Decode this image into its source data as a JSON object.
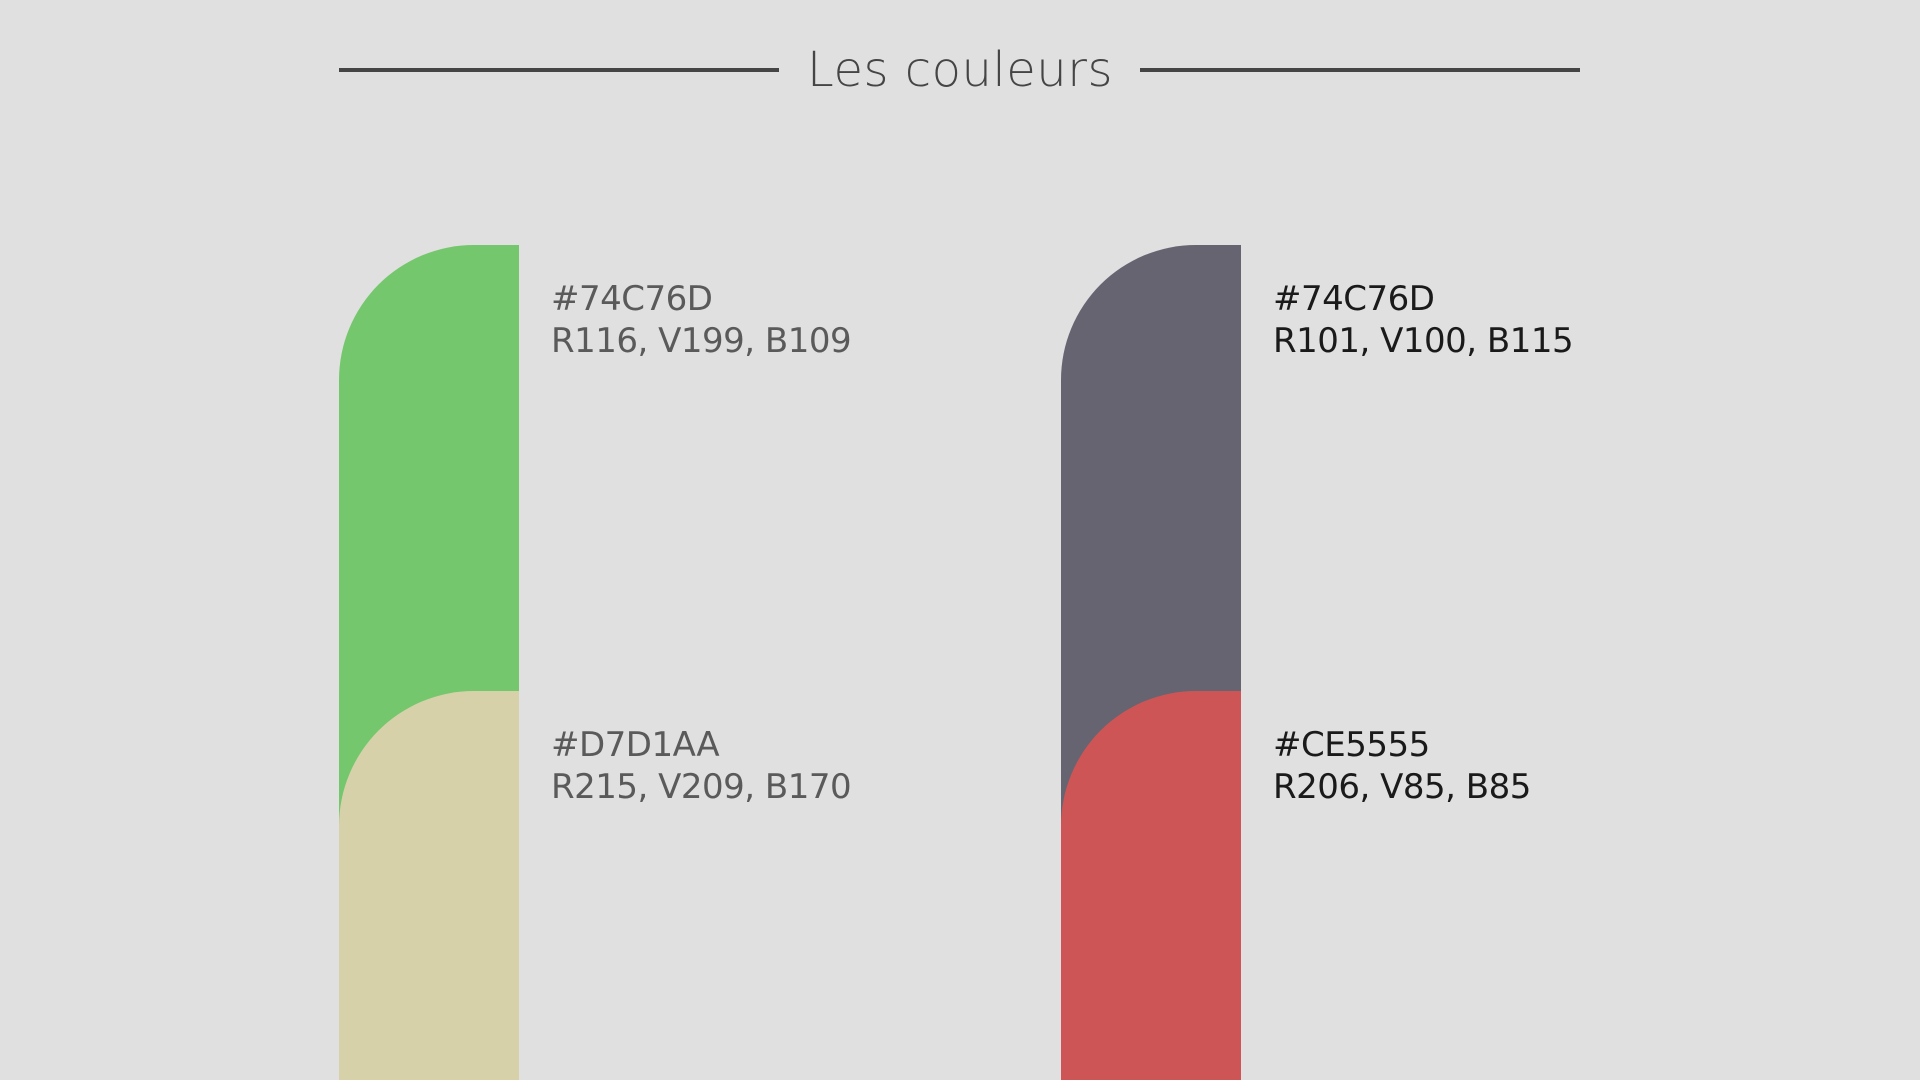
{
  "title": "Les couleurs",
  "colors": [
    {
      "hex": "#74C76D",
      "rgb": "R116, V199, B109",
      "swatch": "#74C76D"
    },
    {
      "hex": "#D7D1AA",
      "rgb": "R215, V209, B170",
      "swatch": "#D7D1AA"
    },
    {
      "hex": "#74C76D",
      "rgb": "R101, V100, B115",
      "swatch": "#656470"
    },
    {
      "hex": "#CE5555",
      "rgb": "R206, V85, B85",
      "swatch": "#CE5555"
    }
  ]
}
